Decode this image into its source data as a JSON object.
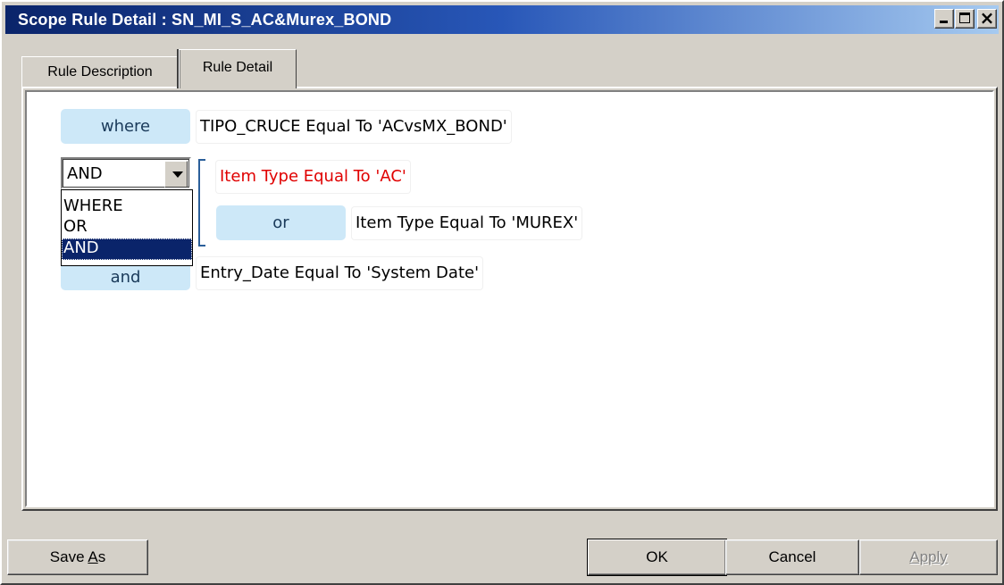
{
  "window": {
    "title": "Scope Rule Detail : SN_MI_S_AC&Murex_BOND",
    "minimize_icon": "minimize-icon",
    "maximize_icon": "maximize-icon",
    "close_icon": "close-icon",
    "close_glyph": "×"
  },
  "tabs": [
    {
      "label": "Rule Description",
      "active": false
    },
    {
      "label": "Rule Detail",
      "active": true
    }
  ],
  "rules": {
    "row1": {
      "operator": "where",
      "condition": "TIPO_CRUCE Equal To 'ACvsMX_BOND'"
    },
    "group": {
      "operator_selected": "AND",
      "row_a": {
        "condition": "Item Type Equal To 'AC'"
      },
      "row_b": {
        "operator": "or",
        "condition": "Item Type Equal To 'MUREX'"
      }
    },
    "row3": {
      "operator": "and",
      "condition": "Entry_Date Equal To 'System Date'"
    }
  },
  "dropdown": {
    "options": [
      "WHERE",
      "OR",
      "AND"
    ],
    "selected": "AND"
  },
  "colors": {
    "highlight_condition": "#e00000",
    "chip": "#cde8f8",
    "selection": "#0a246a"
  },
  "buttons": {
    "save_as": "Save As",
    "save_as_mnemonic": "A",
    "ok": "OK",
    "cancel": "Cancel",
    "apply": "Apply"
  }
}
